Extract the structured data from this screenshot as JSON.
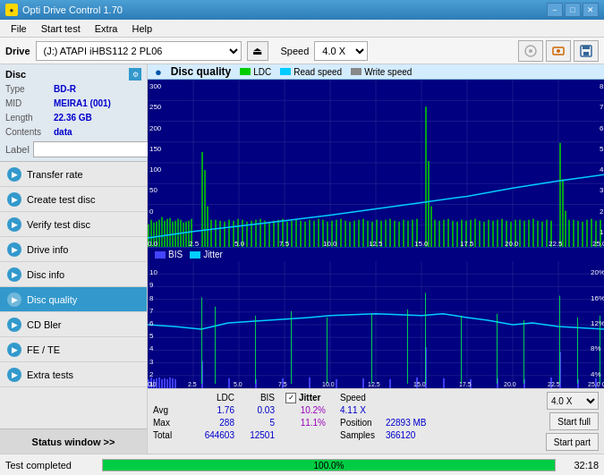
{
  "titlebar": {
    "title": "Opti Drive Control 1.70",
    "minimize": "−",
    "maximize": "□",
    "close": "✕"
  },
  "menu": {
    "items": [
      "File",
      "Start test",
      "Extra",
      "Help"
    ]
  },
  "drivebar": {
    "label": "Drive",
    "drive_value": "(J:)  ATAPI iHBS112  2 PL06",
    "speed_label": "Speed",
    "speed_value": "4.0 X"
  },
  "disc": {
    "title": "Disc",
    "type_label": "Type",
    "type_value": "BD-R",
    "mid_label": "MID",
    "mid_value": "MEIRA1 (001)",
    "length_label": "Length",
    "length_value": "22.36 GB",
    "contents_label": "Contents",
    "contents_value": "data",
    "label_label": "Label"
  },
  "nav": {
    "items": [
      {
        "id": "transfer-rate",
        "label": "Transfer rate",
        "active": false
      },
      {
        "id": "create-test-disc",
        "label": "Create test disc",
        "active": false
      },
      {
        "id": "verify-test-disc",
        "label": "Verify test disc",
        "active": false
      },
      {
        "id": "drive-info",
        "label": "Drive info",
        "active": false
      },
      {
        "id": "disc-info",
        "label": "Disc info",
        "active": false
      },
      {
        "id": "disc-quality",
        "label": "Disc quality",
        "active": true
      },
      {
        "id": "cd-bler",
        "label": "CD Bler",
        "active": false
      },
      {
        "id": "fe-te",
        "label": "FE / TE",
        "active": false
      },
      {
        "id": "extra-tests",
        "label": "Extra tests",
        "active": false
      }
    ]
  },
  "status_window": {
    "label": "Status window >>"
  },
  "chart": {
    "title": "Disc quality",
    "legend": [
      {
        "id": "ldc",
        "label": "LDC",
        "color": "#00cc00"
      },
      {
        "id": "read-speed",
        "label": "Read speed",
        "color": "#00ccff"
      },
      {
        "id": "write-speed",
        "label": "Write speed",
        "color": "#ffffff"
      }
    ],
    "legend2": [
      {
        "id": "bis",
        "label": "BIS",
        "color": "#0044cc"
      },
      {
        "id": "jitter",
        "label": "Jitter",
        "color": "#00ccff"
      }
    ]
  },
  "stats": {
    "col_headers": [
      "LDC",
      "BIS"
    ],
    "rows": [
      {
        "label": "Avg",
        "ldc": "1.76",
        "bis": "0.03",
        "jitter": "10.2%"
      },
      {
        "label": "Max",
        "ldc": "288",
        "bis": "5",
        "jitter": "11.1%"
      },
      {
        "label": "Total",
        "ldc": "644603",
        "bis": "12501",
        "jitter": ""
      }
    ],
    "jitter_checked": true,
    "jitter_label": "Jitter",
    "speed_label": "Speed",
    "speed_value": "4.11 X",
    "position_label": "Position",
    "position_value": "22893 MB",
    "samples_label": "Samples",
    "samples_value": "366120",
    "speed_select": "4.0 X",
    "start_full": "Start full",
    "start_part": "Start part"
  },
  "bottom": {
    "status": "Test completed",
    "progress": 100.0,
    "progress_text": "100.0%",
    "time": "32:18"
  }
}
